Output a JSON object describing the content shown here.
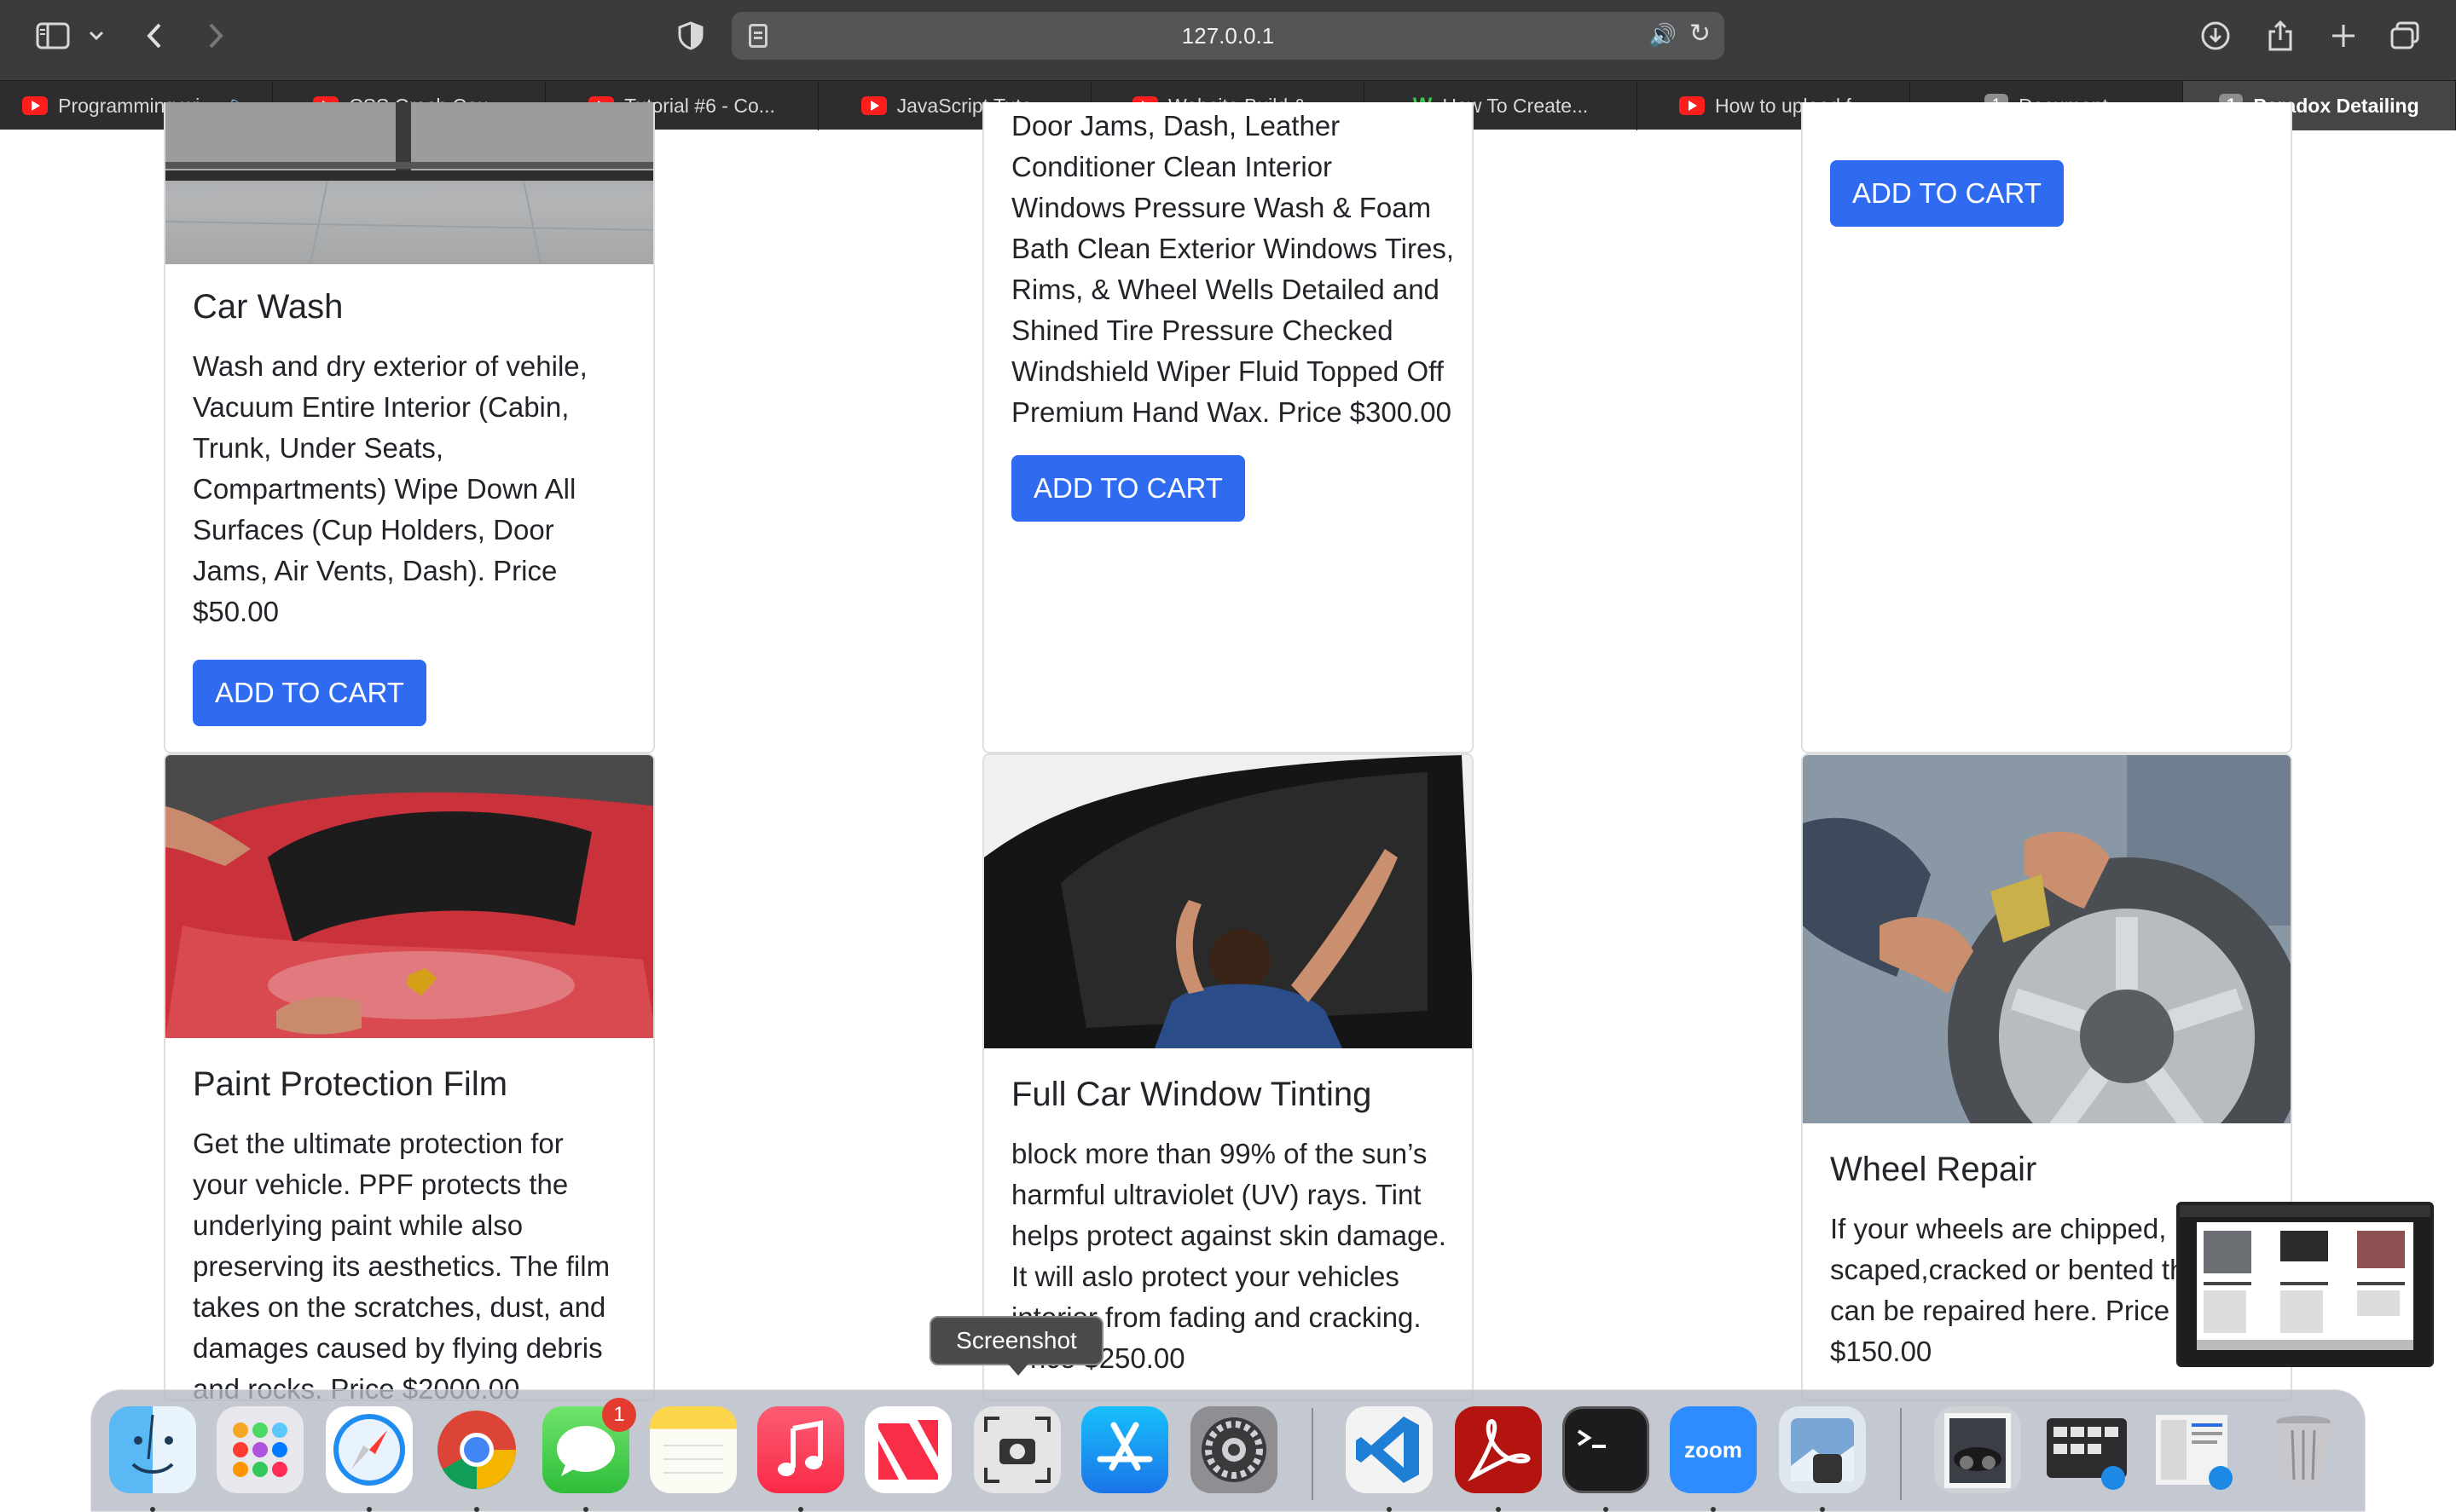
{
  "browser": {
    "address": "127.0.0.1",
    "tabs": [
      {
        "title": "Programming wi...",
        "icon": "youtube-icon"
      },
      {
        "title": "CSS Crash Cou...",
        "icon": "youtube-icon"
      },
      {
        "title": "Tutorial #6 - Co...",
        "icon": "youtube-icon"
      },
      {
        "title": "JavaScript Tuto...",
        "icon": "youtube-icon"
      },
      {
        "title": "Website Build &...",
        "icon": "youtube-icon"
      },
      {
        "title": "How To Create...",
        "icon": "w-icon"
      },
      {
        "title": "How to upload f...",
        "icon": "youtube-icon"
      },
      {
        "title": "Document",
        "badge": "1"
      },
      {
        "title": "Paradox Detailing",
        "badge": "1",
        "active": true
      }
    ]
  },
  "cards": {
    "car_wash": {
      "title": "Car Wash",
      "lines": [
        "Wash and dry exterior of vehile,",
        "Vacuum Entire Interior (Cabin,",
        "Trunk, Under Seats,",
        "Compartments) Wipe Down All",
        "Surfaces (Cup Holders, Door",
        "Jams, Air Vents, Dash). Price",
        "$50.00"
      ],
      "button": "ADD TO CART"
    },
    "full_detail": {
      "lines": [
        "Door Jams, Dash, Leather",
        "Conditioner Clean Interior",
        "Windows Pressure Wash & Foam",
        "Bath Clean Exterior Windows Tires,",
        "Rims, & Wheel Wells Detailed and",
        "Shined Tire Pressure Checked",
        "Windshield Wiper Fluid Topped Off",
        "Premium Hand Wax. Price $300.00"
      ],
      "button": "ADD TO CART"
    },
    "third_top": {
      "button": "ADD TO CART"
    },
    "ppf": {
      "title": "Paint Protection Film",
      "lines": [
        "Get the ultimate protection for",
        "your vehicle. PPF protects the",
        "underlying paint while also",
        "preserving its aesthetics. The film",
        "takes on the scratches, dust, and",
        "damages caused by flying debris",
        "and rocks. Price $2000.00"
      ]
    },
    "tint": {
      "title": "Full Car Window Tinting",
      "lines": [
        "block more than 99% of the sun’s",
        "harmful ultraviolet (UV) rays. Tint",
        "helps protect against skin damage.",
        "It will aslo protect your vehicles",
        "interior from fading and cracking.",
        "Price $250.00"
      ]
    },
    "wheel": {
      "title": "Wheel Repair",
      "lines": [
        "If your wheels are chipped,",
        "scaped,cracked or bented they",
        "can be repaired here. Price",
        "$150.00"
      ]
    }
  },
  "tooltip": "Screenshot",
  "dock": {
    "messages_badge": "1",
    "zoom_label": "zoom",
    "apps": [
      "finder-icon",
      "launchpad-icon",
      "safari-icon",
      "chrome-icon",
      "messages-icon",
      "notes-icon",
      "music-icon",
      "news-icon",
      "screenshot-icon",
      "app-store-icon",
      "system-settings-icon",
      "vscode-icon",
      "acrobat-icon",
      "terminal-icon",
      "zoom-icon",
      "preview-icon",
      "photo-stack-icon",
      "downloads-stack-icon",
      "documents-stack-icon",
      "trash-icon"
    ]
  },
  "colors": {
    "button": "#2f6bf0",
    "toolbar": "#3b3b3d",
    "tabbar": "#2d2d2f"
  }
}
